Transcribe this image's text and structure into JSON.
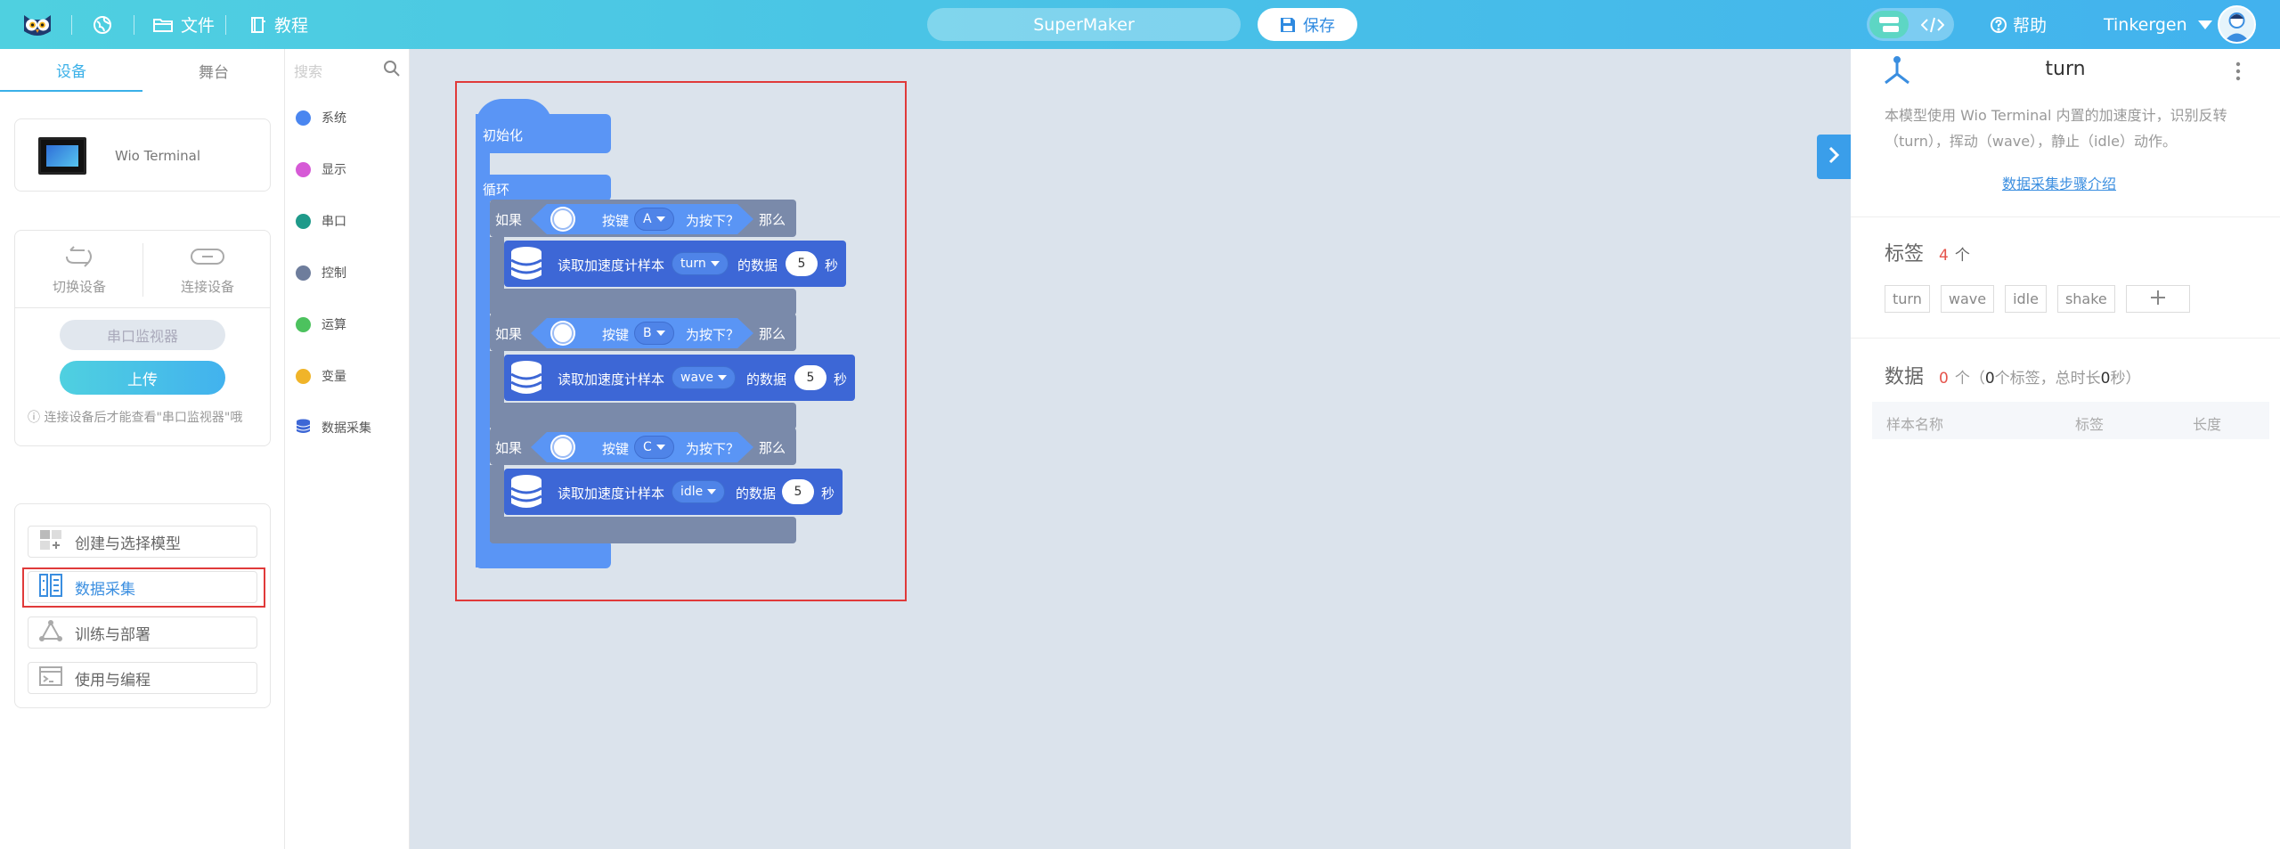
{
  "topbar": {
    "file_label": "文件",
    "tutorial_label": "教程",
    "project_name": "SuperMaker",
    "save_label": "保存",
    "help_label": "帮助",
    "user_name": "Tinkergen"
  },
  "left": {
    "tabs": [
      "设备",
      "舞台"
    ],
    "active_tab": "设备",
    "device_name": "Wio Terminal",
    "switch_device": "切换设备",
    "connect_device": "连接设备",
    "serial_monitor": "串口监视器",
    "upload": "上传",
    "hint": "连接设备后才能查看\"串口监视器\"哦",
    "steps": [
      "创建与选择模型",
      "数据采集",
      "训练与部署",
      "使用与编程"
    ],
    "active_step": "数据采集"
  },
  "palette": {
    "search_placeholder": "搜索",
    "categories": [
      {
        "label": "系统",
        "color": "#4a86f0"
      },
      {
        "label": "显示",
        "color": "#d65ad6"
      },
      {
        "label": "串口",
        "color": "#1f9a8a"
      },
      {
        "label": "控制",
        "color": "#6e7d9c"
      },
      {
        "label": "运算",
        "color": "#4cc25e"
      },
      {
        "label": "变量",
        "color": "#f0b429"
      },
      {
        "label": "数据采集",
        "color": "#3d67d6"
      }
    ]
  },
  "blocks": {
    "init_label": "初始化",
    "loop_label": "循环",
    "if_label": "如果",
    "then_label": "那么",
    "key_label": "按键",
    "pressed_label": "为按下？",
    "read_label": "读取加速度计样本",
    "data_of_label": "的数据",
    "seconds_label": "秒",
    "rows": [
      {
        "key": "A",
        "sample": "turn",
        "secs": "5"
      },
      {
        "key": "B",
        "sample": "wave",
        "secs": "5"
      },
      {
        "key": "C",
        "sample": "idle",
        "secs": "5"
      }
    ]
  },
  "right": {
    "model_title": "turn",
    "description": "本模型使用 Wio Terminal 内置的加速度计，识别反转（turn），挥动（wave），静止（idle）动作。",
    "link": "数据采集步骤介绍",
    "tags_title": "标签",
    "tags_count": "4",
    "tags_unit": "个",
    "tags": [
      "turn",
      "wave",
      "idle",
      "shake"
    ],
    "data_title": "数据",
    "data_count": "0",
    "data_mid": "个（",
    "data_tag_count": "0",
    "data_tag_text": "个标签，总时长",
    "data_duration": "0",
    "data_end": "秒）",
    "columns": [
      "样本名称",
      "标签",
      "长度"
    ],
    "accent": "#e5534b"
  }
}
